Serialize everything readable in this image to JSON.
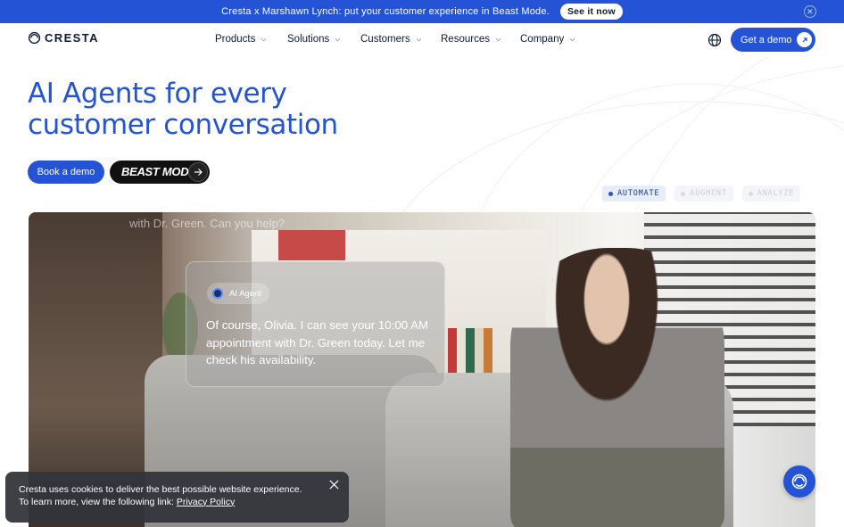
{
  "announcement": {
    "text": "Cresta x Marshawn Lynch: put your customer experience in Beast Mode.",
    "cta": "See it now"
  },
  "nav": {
    "logo": "CRESTA",
    "links": [
      "Products",
      "Solutions",
      "Customers",
      "Resources",
      "Company"
    ],
    "demo_button": "Get a demo"
  },
  "hero": {
    "headline_line1": "AI Agents for every",
    "headline_line2": "customer conversation",
    "book_demo": "Book a demo",
    "beast_mode": "BEAST MODE"
  },
  "tabs": [
    {
      "label": "AUTOMATE",
      "active": true
    },
    {
      "label": "AUGMENT",
      "active": false
    },
    {
      "label": "ANALYZE",
      "active": false
    }
  ],
  "video": {
    "faded_text": "with Dr. Green. Can you help?",
    "chip_label": "AI Agent",
    "message": "Of course, Olivia. I can see your 10:00 AM appointment with Dr. Green today. Let me check his availability."
  },
  "cookie": {
    "text": "Cresta uses cookies to deliver the best possible website experience. To learn more, view the following link:",
    "link": "Privacy Policy"
  },
  "colors": {
    "brand_blue": "#2453d6",
    "dark": "#0b1b3a"
  }
}
